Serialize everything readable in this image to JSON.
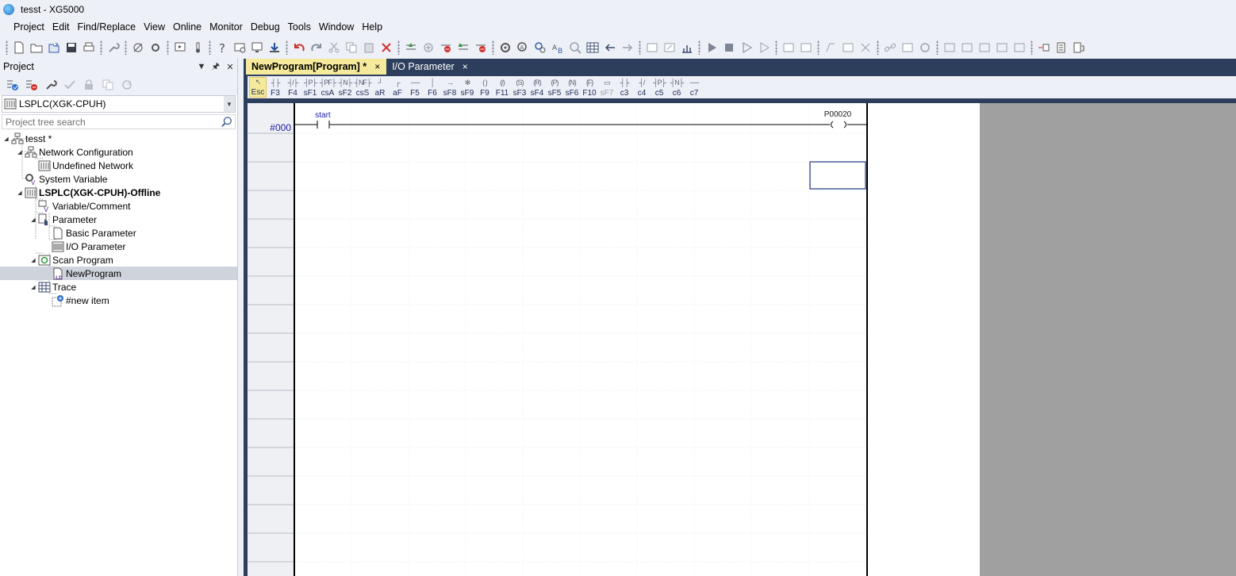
{
  "window": {
    "title": "tesst - XG5000"
  },
  "menu": [
    "Project",
    "Edit",
    "Find/Replace",
    "View",
    "Online",
    "Monitor",
    "Debug",
    "Tools",
    "Window",
    "Help"
  ],
  "project_panel": {
    "title": "Project",
    "device_combo": "LSPLC(XGK-CPUH)",
    "search_placeholder": "Project tree search",
    "tree": [
      {
        "label": "tesst *",
        "icon": "project-icon"
      },
      {
        "label": "Network Configuration",
        "icon": "network-icon"
      },
      {
        "label": "Undefined Network",
        "icon": "plc-icon"
      },
      {
        "label": "System Variable",
        "icon": "system-variable-icon"
      },
      {
        "label": "LSPLC(XGK-CPUH)-Offline",
        "icon": "plc-icon"
      },
      {
        "label": "Variable/Comment",
        "icon": "variable-icon"
      },
      {
        "label": "Parameter",
        "icon": "parameter-icon"
      },
      {
        "label": "Basic Parameter",
        "icon": "document-icon"
      },
      {
        "label": "I/O Parameter",
        "icon": "io-icon"
      },
      {
        "label": "Scan Program",
        "icon": "scan-program-icon"
      },
      {
        "label": "NewProgram",
        "icon": "ld-program-icon"
      },
      {
        "label": "Trace",
        "icon": "trace-icon"
      },
      {
        "label": "#new item",
        "icon": "trace-item-icon"
      }
    ]
  },
  "tabs": [
    {
      "label": "NewProgram[Program] *",
      "close": "×"
    },
    {
      "label": "I/O Parameter",
      "close": "×"
    }
  ],
  "ladder_toolbar": [
    "Esc",
    "F3",
    "F4",
    "sF1",
    "csA",
    "sF2",
    "csS",
    "aR",
    "aF",
    "F5",
    "F6",
    "sF8",
    "sF9",
    "F9",
    "F11",
    "sF3",
    "sF4",
    "sF5",
    "sF6",
    "F10",
    "sF7",
    "c3",
    "c4",
    "c5",
    "c6",
    "c7"
  ],
  "ladder": {
    "step_label": "#000",
    "contact_label": "start",
    "coil_label": "P00020"
  },
  "colors": {
    "active_tab": "#f5e99b",
    "doc_background": "#2c3e5c",
    "step_label": "#1a1aa6"
  }
}
